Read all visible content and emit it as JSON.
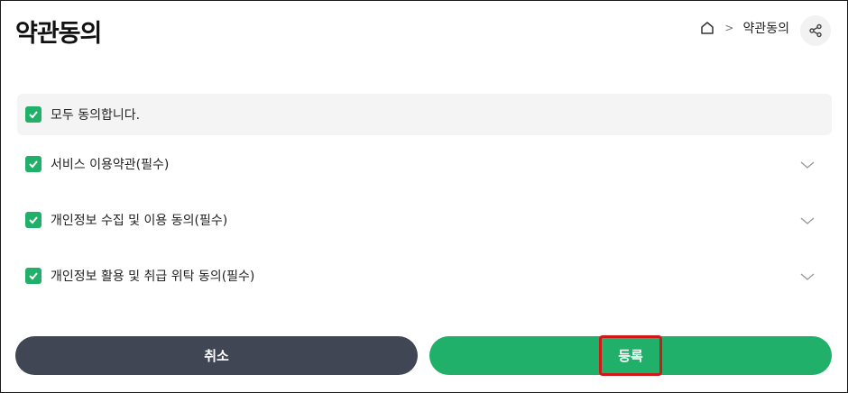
{
  "header": {
    "title": "약관동의",
    "breadcrumb": {
      "home_icon": "home-icon",
      "separator": ">",
      "current": "약관동의"
    },
    "share_icon": "share-icon"
  },
  "agree_all": {
    "checked": true,
    "label": "모두 동의합니다."
  },
  "terms": [
    {
      "label": "서비스 이용약관(필수)",
      "checked": true
    },
    {
      "label": "개인정보 수집 및 이용 동의(필수)",
      "checked": true
    },
    {
      "label": "개인정보 활용 및 취급 위탁 동의(필수)",
      "checked": true
    }
  ],
  "buttons": {
    "cancel_label": "취소",
    "submit_label": "등록"
  },
  "colors": {
    "accent": "#20b06a",
    "cancel": "#414654",
    "highlight": "#d01818"
  }
}
